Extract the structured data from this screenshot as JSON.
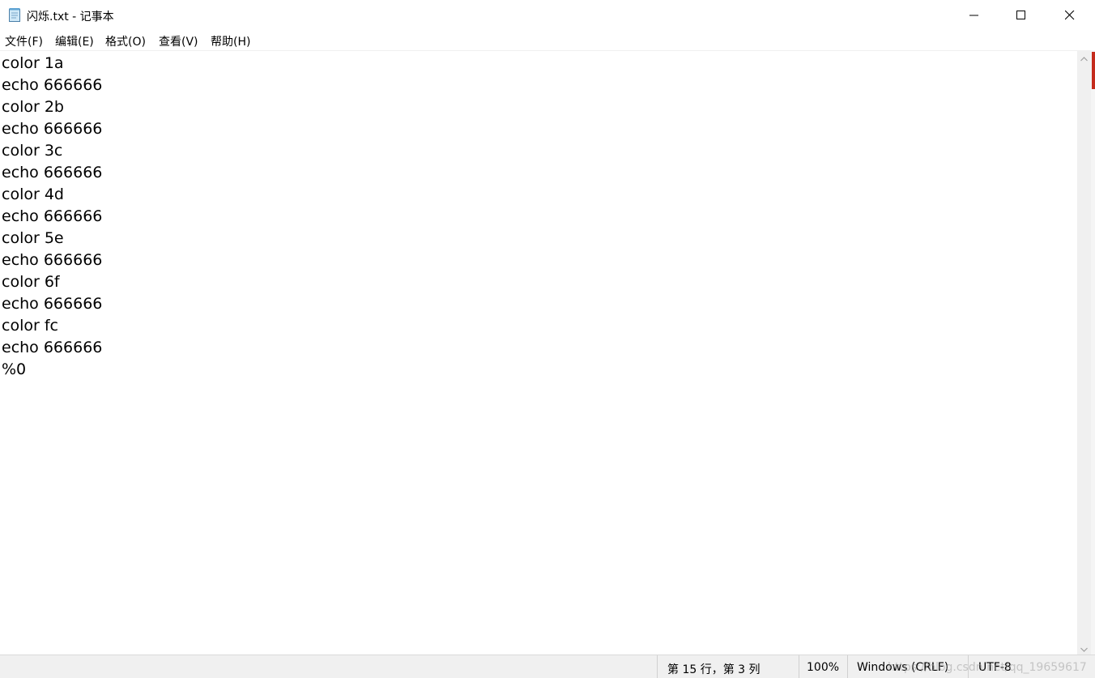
{
  "window": {
    "title": "闪烁.txt - 记事本",
    "icon": "notepad-icon",
    "controls": {
      "minimize": "minimize-icon",
      "maximize": "maximize-icon",
      "close": "close-icon"
    }
  },
  "menu": {
    "items": [
      {
        "label": "文件(F)"
      },
      {
        "label": "编辑(E)"
      },
      {
        "label": "格式(O)"
      },
      {
        "label": "查看(V)"
      },
      {
        "label": "帮助(H)"
      }
    ]
  },
  "editor": {
    "lines": [
      "color 1a",
      "echo 666666",
      "color 2b",
      "echo 666666",
      "color 3c",
      "echo 666666",
      "color 4d",
      "echo 666666",
      "color 5e",
      "echo 666666",
      "color 6f",
      "echo 666666",
      "color fc",
      "echo 666666",
      "%0"
    ]
  },
  "status": {
    "position": "第 15 行，第 3 列",
    "zoom": "100%",
    "line_ending": "Windows (CRLF)",
    "encoding": "UTF-8",
    "watermark": "https://blog.csdn.net/qq_19659617"
  },
  "colors": {
    "background": "#ffffff",
    "statusbar": "#f0f0f0",
    "text": "#000000",
    "close_hover": "#e81123"
  }
}
